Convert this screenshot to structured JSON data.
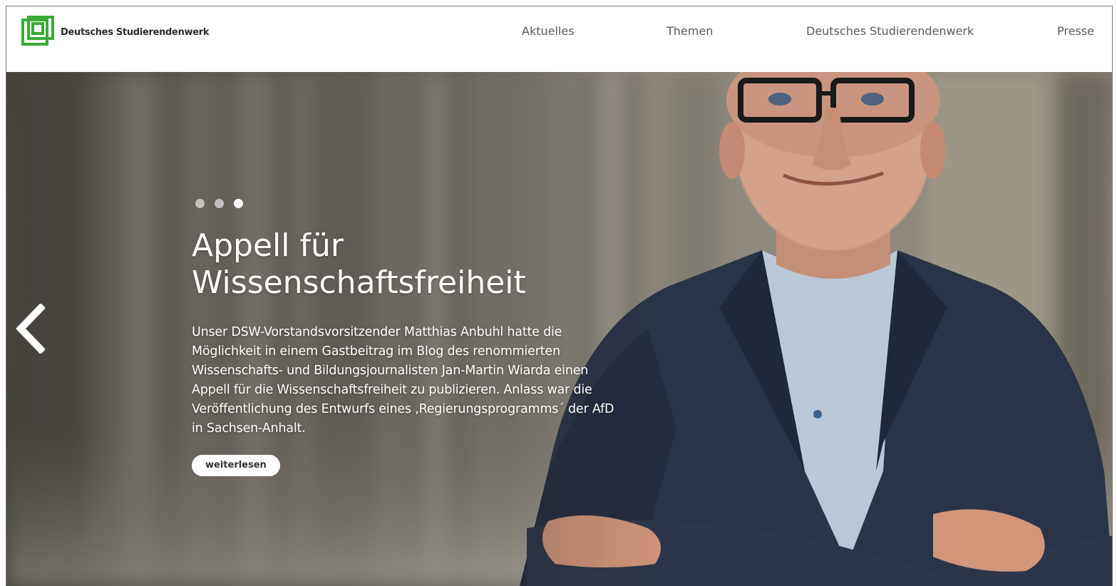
{
  "header": {
    "brand_name": "Deutsches Studierendenwerk",
    "logo_icon": "dsw-logo-icon",
    "brand_color": "#3aaa35"
  },
  "nav": {
    "items": [
      {
        "label": "Aktuelles"
      },
      {
        "label": "Themen"
      },
      {
        "label": "Deutsches Studierendenwerk"
      },
      {
        "label": "Presse"
      }
    ]
  },
  "hero": {
    "slide_count": 3,
    "active_slide": 3,
    "title_line1": "Appell für",
    "title_line2": "Wissenschaftsfreiheit",
    "teaser": "Unser DSW-Vorstandsvorsitzender Matthias Anbuhl hatte die Möglichkeit in einem Gastbeitrag im Blog des renommierten Wissenschafts- und Bildungsjournalisten Jan-Martin Wiarda einen Appell für die Wissenschaftsfreiheit zu publizieren. Anlass war die Veröffentlichung des Entwurfs eines ‚Regierungsprogramms´ der AfD in Sachsen-Anhalt.",
    "button_label": "weiterlesen",
    "prev_icon": "chevron-left-icon"
  }
}
